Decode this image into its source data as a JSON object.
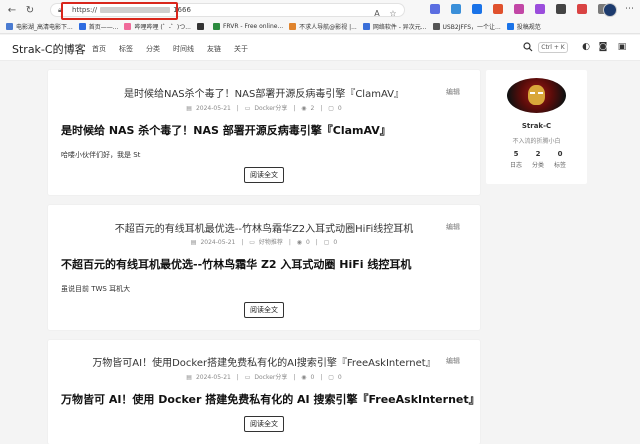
{
  "browser": {
    "url_prefix": "https://",
    "url_suffix": "1666",
    "extension_colors": [
      "#5b6ee1",
      "#3a8fd9",
      "#1a73e8",
      "#e0512d",
      "#c247a6",
      "#9b4ddc",
      "#444444",
      "#d94343",
      "#7a7a7a"
    ]
  },
  "bookmarks": [
    {
      "label": "电影湖_高清电影下...",
      "color": "#4a7bd1"
    },
    {
      "label": "首页——...",
      "color": "#2d6be0"
    },
    {
      "label": "哔哩哔哩 (゜-゜)つ...",
      "color": "#f06a9a"
    },
    {
      "label": "",
      "color": "#333333"
    },
    {
      "label": "FRVR - Free online...",
      "color": "#2b8a3e"
    },
    {
      "label": "不求人导航@影视 |...",
      "color": "#e0842d"
    },
    {
      "label": "网络软件 - 异次元...",
      "color": "#3a6fd9"
    },
    {
      "label": "USB2JFFS，一个让...",
      "color": "#555555"
    },
    {
      "label": "投稿规范",
      "color": "#1a73e8"
    }
  ],
  "site": {
    "logo": "Strak-C的博客",
    "nav": [
      "首页",
      "标签",
      "分类",
      "时间线",
      "友链",
      "关于"
    ],
    "search_shortcut": "Ctrl + K"
  },
  "posts": [
    {
      "title": "是时候给NAS杀个毒了！NAS部署开源反病毒引擎『ClamAV』",
      "edit": "编辑",
      "date": "2024-05-21",
      "category": "Docker分享",
      "views": "2",
      "comments": "0",
      "body_title": "是时候给 NAS 杀个毒了！NAS 部署开源反病毒引擎『ClamAV』",
      "excerpt": "哈喽小伙伴们好，我是 St",
      "read_more": "阅读全文"
    },
    {
      "title": "不超百元的有线耳机最优选--竹林鸟霜华Z2入耳式动圈HiFi线控耳机",
      "edit": "编辑",
      "date": "2024-05-21",
      "category": "好物推荐",
      "views": "0",
      "comments": "0",
      "body_title": "不超百元的有线耳机最优选--竹林鸟霜华 Z2 入耳式动圈 HiFi 线控耳机",
      "excerpt": "虽说目前 TWS 耳机大",
      "read_more": "阅读全文"
    },
    {
      "title": "万物皆可AI！使用Docker搭建免费私有化的AI搜索引擎『FreeAskInternet』",
      "edit": "编辑",
      "date": "2024-05-21",
      "category": "Docker分享",
      "views": "0",
      "comments": "0",
      "body_title": "万物皆可 AI！使用 Docker 搭建免费私有化的 AI 搜索引擎『FreeAskInternet』",
      "excerpt": "",
      "read_more": "阅读全文"
    }
  ],
  "profile": {
    "name": "Strak-C",
    "motto": "不入流的折腾小白",
    "stats": [
      {
        "num": "5",
        "label": "日志"
      },
      {
        "num": "2",
        "label": "分类"
      },
      {
        "num": "0",
        "label": "标签"
      }
    ]
  }
}
